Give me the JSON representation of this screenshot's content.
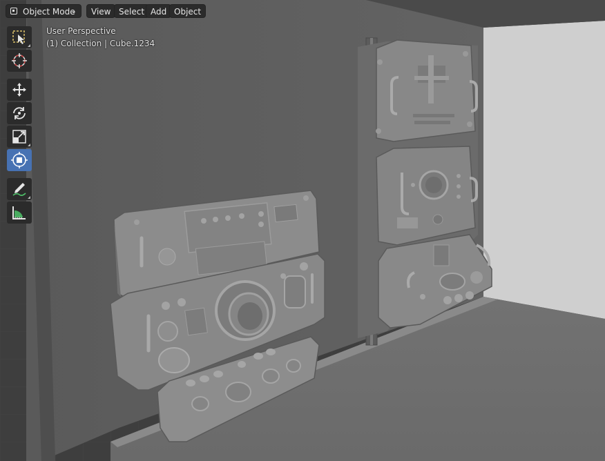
{
  "header": {
    "mode": "Object Mode",
    "mode_icon": "object-mode-icon",
    "menus": [
      "View",
      "Select",
      "Add",
      "Object"
    ]
  },
  "overlay": {
    "perspective": "User Perspective",
    "collection": "(1) Collection | Cube.1234"
  },
  "toolbar": {
    "tools": [
      "select-box-icon",
      "cursor-icon",
      "move-icon",
      "rotate-icon",
      "scale-icon",
      "transform-icon",
      "annotate-icon",
      "measure-icon"
    ],
    "active_tool": "transform-icon"
  },
  "colors": {
    "viewport_bg": "#3d3d3d",
    "wall": "#5e5e5e",
    "panel": "#8a8a8a",
    "active_tool": "#4772b3"
  }
}
